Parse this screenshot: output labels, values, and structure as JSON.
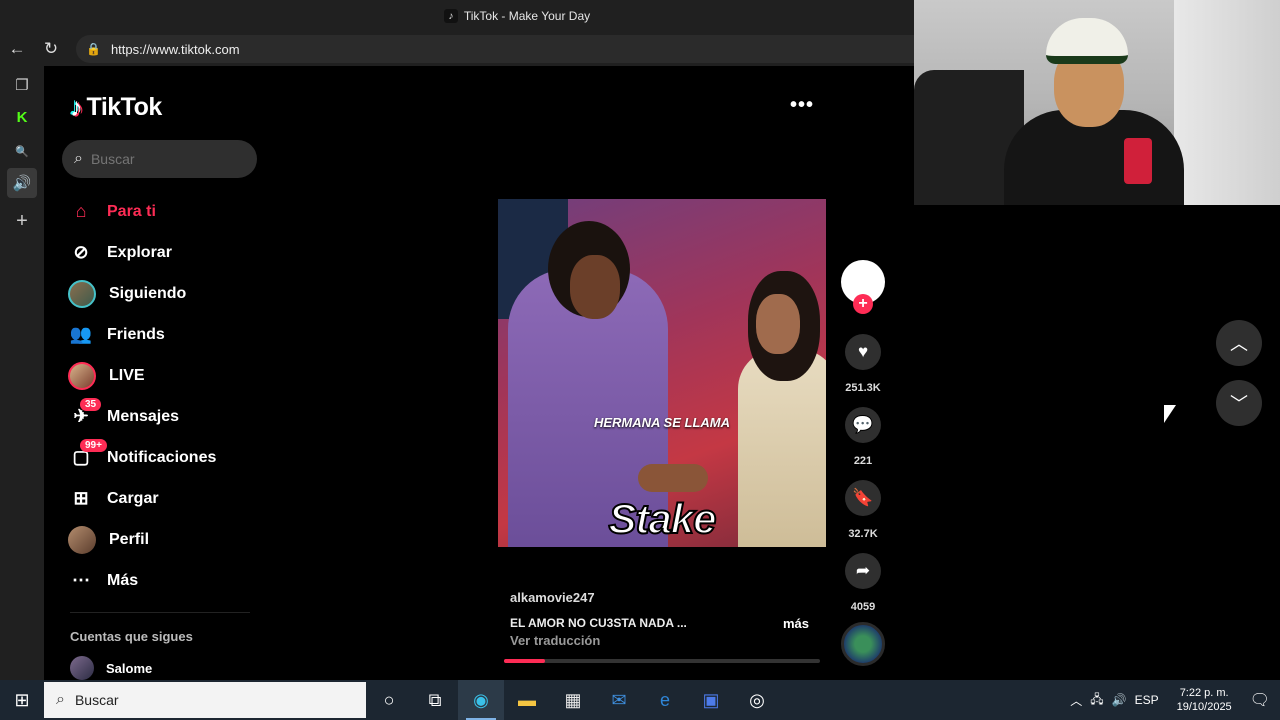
{
  "browser": {
    "tab_title": "TikTok - Make Your Day",
    "url": "https://www.tiktok.com"
  },
  "sidebar": {
    "brand": "TikTok",
    "search_placeholder": "Buscar",
    "items": [
      {
        "label": "Para ti",
        "icon": "home-icon",
        "active": true
      },
      {
        "label": "Explorar",
        "icon": "compass-icon"
      },
      {
        "label": "Siguiendo",
        "icon": "avatar"
      },
      {
        "label": "Friends",
        "icon": "friends-icon"
      },
      {
        "label": "LIVE",
        "icon": "avatar"
      },
      {
        "label": "Mensajes",
        "icon": "messages-icon",
        "badge": "35"
      },
      {
        "label": "Notificaciones",
        "icon": "inbox-icon",
        "badge": "99+"
      },
      {
        "label": "Cargar",
        "icon": "upload-icon"
      },
      {
        "label": "Perfil",
        "icon": "avatar"
      },
      {
        "label": "Más",
        "icon": "more-dots-icon"
      }
    ],
    "following_heading": "Cuentas que sigues",
    "following": [
      {
        "name": "Salome"
      }
    ]
  },
  "video": {
    "overlay_caption": "HERMANA SE LLAMA",
    "watermark": "Stake",
    "author": "alkamovie247",
    "description": "EL AMOR NO CU3STA NADA ...",
    "more_label": "más",
    "translate_label": "Ver traducción",
    "progress": 0.13
  },
  "actions": {
    "likes": "251.3K",
    "comments": "221",
    "saves": "32.7K",
    "shares": "4059"
  },
  "taskbar": {
    "search_placeholder": "Buscar",
    "language": "ESP",
    "time": "7:22 p. m.",
    "date": "19/10/2025"
  },
  "colors": {
    "accent": "#fe2c55",
    "page_bg": "#000000",
    "taskbar_bg": "#1c2631"
  }
}
